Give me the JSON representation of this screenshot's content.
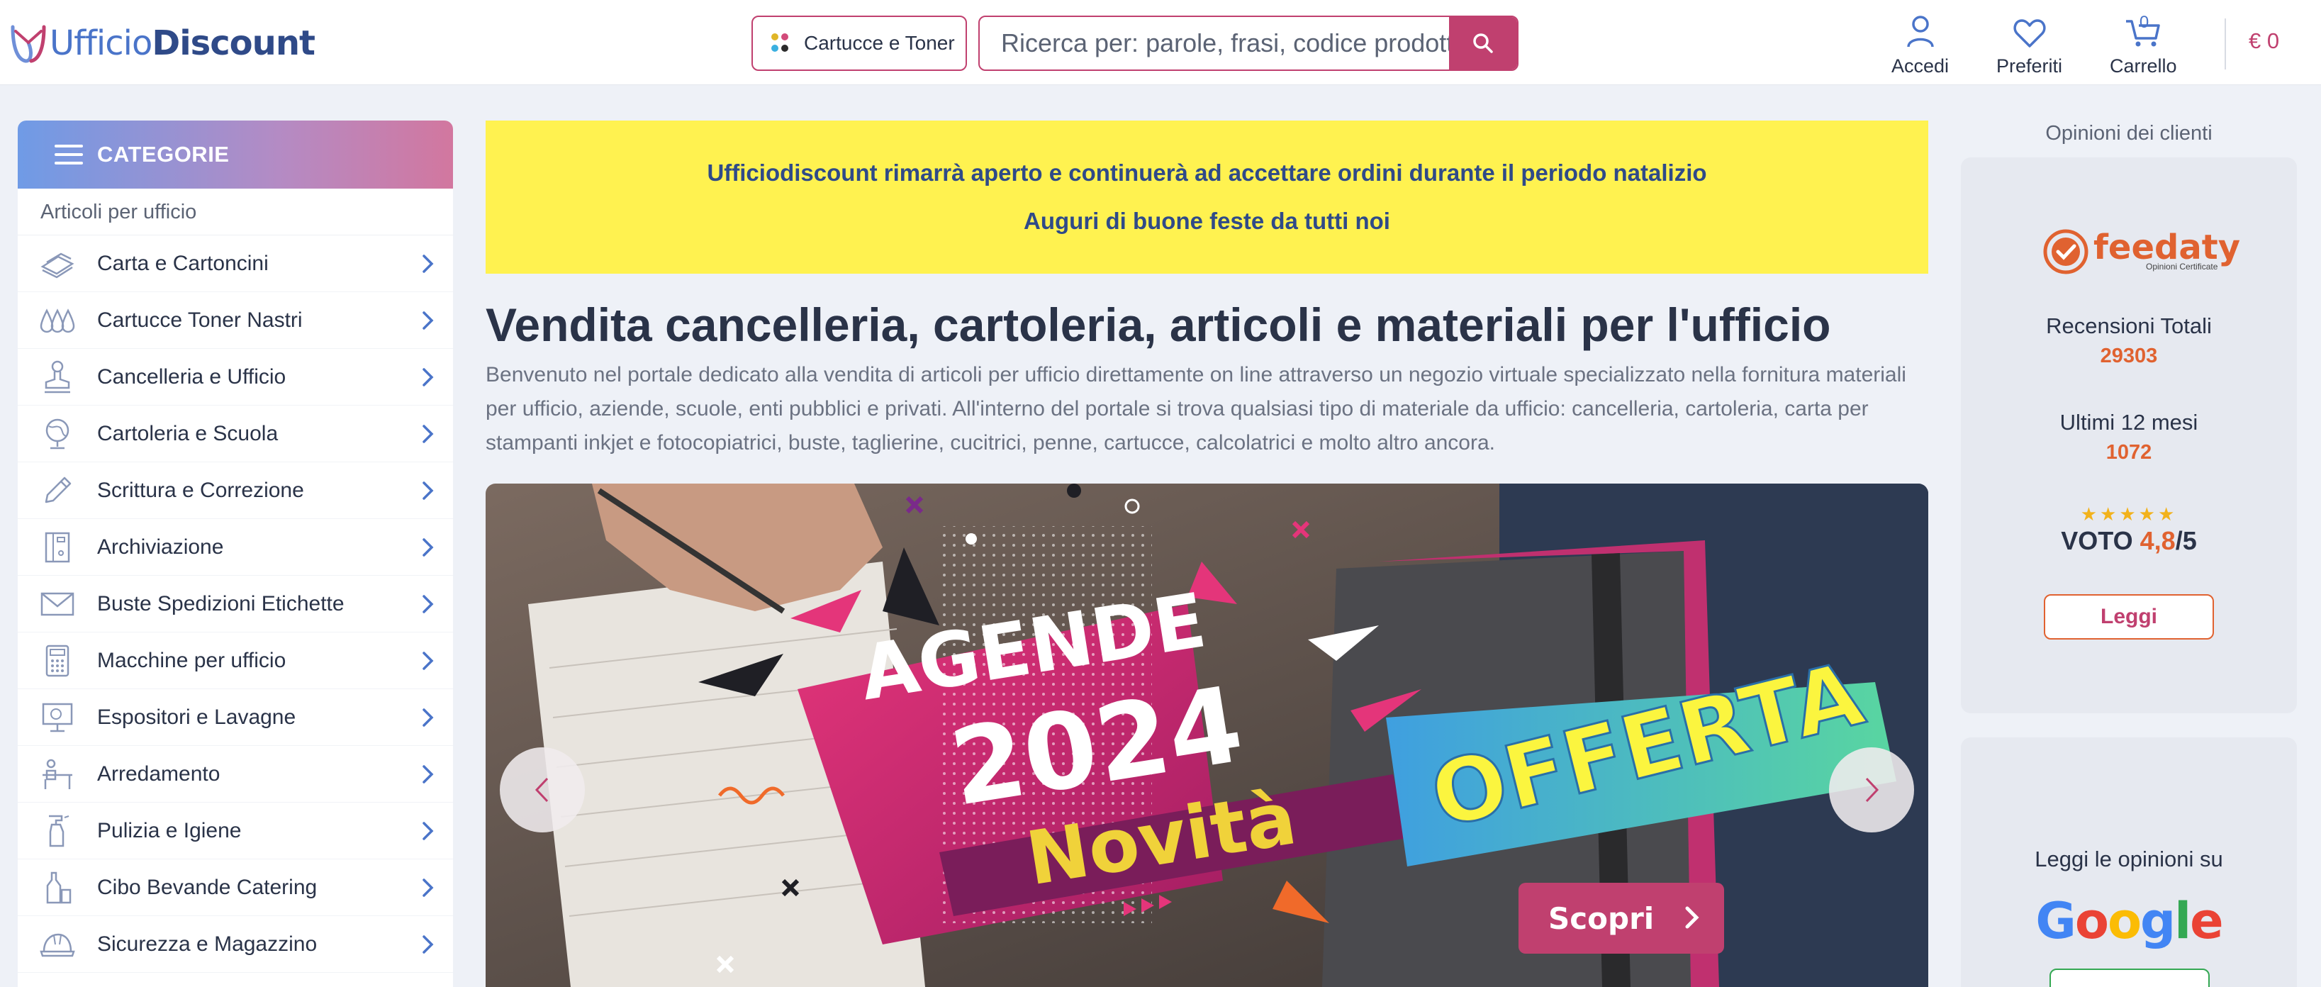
{
  "header": {
    "logo_part1": "Ufficio",
    "logo_part2": "Discount",
    "categories_button": "Cartucce e Toner",
    "search_placeholder": "Ricerca per: parole, frasi, codice prodotto",
    "account_label": "Accedi",
    "favorites_label": "Preferiti",
    "cart_label": "Carrello",
    "cart_count": "0",
    "cart_total": "€ 0"
  },
  "sidebar": {
    "title": "CATEGORIE",
    "subtitle": "Articoli per ufficio",
    "items": [
      {
        "label": "Carta e Cartoncini",
        "icon": "paper-stack-icon"
      },
      {
        "label": "Cartucce Toner Nastri",
        "icon": "ink-drops-icon"
      },
      {
        "label": "Cancelleria e Ufficio",
        "icon": "stamp-icon"
      },
      {
        "label": "Cartoleria e Scuola",
        "icon": "globe-icon"
      },
      {
        "label": "Scrittura e Correzione",
        "icon": "pencil-icon"
      },
      {
        "label": "Archiviazione",
        "icon": "binder-icon"
      },
      {
        "label": "Buste Spedizioni Etichette",
        "icon": "envelope-icon"
      },
      {
        "label": "Macchine per ufficio",
        "icon": "calculator-icon"
      },
      {
        "label": "Espositori e Lavagne",
        "icon": "whiteboard-icon"
      },
      {
        "label": "Arredamento",
        "icon": "desk-icon"
      },
      {
        "label": "Pulizia e Igiene",
        "icon": "spray-bottle-icon"
      },
      {
        "label": "Cibo Bevande Catering",
        "icon": "bottle-icon"
      },
      {
        "label": "Sicurezza e Magazzino",
        "icon": "helmet-icon"
      }
    ]
  },
  "banner": {
    "line1": "Ufficiodiscount rimarrà aperto e continuerà ad accettare ordini durante il periodo natalizio",
    "line2": "Auguri di buone feste da tutti noi"
  },
  "main": {
    "title": "Vendita cancelleria, cartoleria, articoli e materiali per l'ufficio",
    "intro": "Benvenuto nel portale dedicato alla vendita di articoli per ufficio direttamente on line attraverso un negozio virtuale specializzato nella fornitura materiali per ufficio, aziende, scuole, enti pubblici e privati. All'interno del portale si trova qualsiasi tipo di materiale da ufficio: cancelleria, cartoleria, carta per stampanti inkjet e fotocopiatrici, buste, taglierine, cucitrici, penne, cartucce, calcolatrici e molto altro ancora."
  },
  "slider": {
    "word1": "AGENDE",
    "word2": "2024",
    "word3": "Novità",
    "word4": "OFFERTA",
    "cta": "Scopri"
  },
  "reviews": {
    "title": "Opinioni dei clienti",
    "brand": "feedaty",
    "brand_sub": "Opinioni Certificate",
    "total_label": "Recensioni Totali",
    "total_value": "29303",
    "recent_label": "Ultimi 12 mesi",
    "recent_value": "1072",
    "stars": "★★★★★",
    "vote_label": "VOTO",
    "vote_value": "4,8",
    "vote_max": "/5",
    "read_button": "Leggi",
    "google_label": "Leggi le opinioni su",
    "google_word": [
      "G",
      "o",
      "o",
      "g",
      "l",
      "e"
    ]
  },
  "colors": {
    "accent": "#c0406f",
    "brand_blue": "#2f4a88",
    "banner_yellow": "#fff250",
    "feedaty_orange": "#e06230"
  }
}
